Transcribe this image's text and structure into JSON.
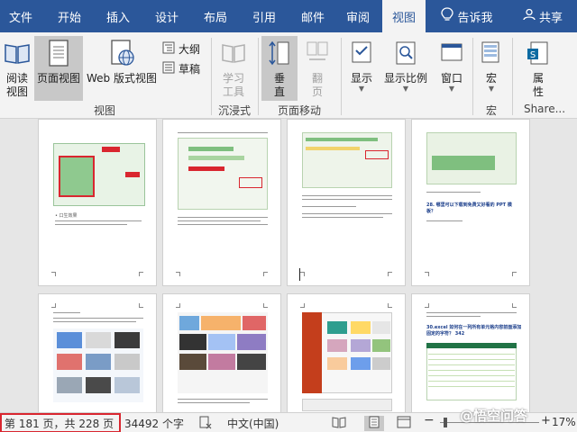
{
  "ribbon_tabs": [
    "文件",
    "开始",
    "插入",
    "设计",
    "布局",
    "引用",
    "邮件",
    "审阅",
    "视图"
  ],
  "tell_me": "告诉我",
  "share": "共享",
  "views_group": {
    "reading_mode": "阅读视图",
    "print_layout": "页面视图",
    "web_layout": "Web 版式视图",
    "outline": "大纲",
    "draft": "草稿",
    "label": "视图"
  },
  "immersive_group": {
    "learning_tools": "学习工具",
    "label": "沉浸式"
  },
  "page_movement_group": {
    "vertical": "垂直",
    "side_to_side": "翻页",
    "label": "页面移动"
  },
  "show_button": "显示",
  "zoom_button": "显示比例",
  "window_button": "窗口",
  "macros_group": {
    "macros": "宏",
    "label": "宏"
  },
  "sharepoint_group": {
    "properties": "属性",
    "label": "Share..."
  },
  "status_bar": {
    "page_info": "第 181 页，共 228 页",
    "word_count": "34492 个字",
    "language": "中文(中国)",
    "zoom_level": "17%"
  },
  "watermark": "@悟空问答",
  "page_snippets": {
    "p1": "• 口生效果",
    "p4_heading": "28. 哪里可以下载到免费又好看的 PPT 模板？",
    "p8_heading": "30.excel 如何在一列所有单元格内容前面添加固定的字符？ 342"
  },
  "colors": {
    "accent": "#2b579a",
    "highlight_red": "#d9262f"
  }
}
